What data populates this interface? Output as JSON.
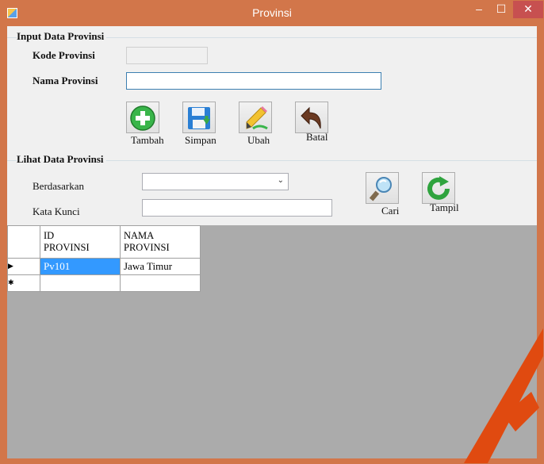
{
  "window": {
    "title": "Provinsi",
    "min_glyph": "–",
    "max_glyph": "☐",
    "close_glyph": "✕"
  },
  "input_group": {
    "title": "Input Data Provinsi",
    "kode_label": "Kode Provinsi",
    "kode_value": "",
    "nama_label": "Nama Provinsi",
    "nama_value": "",
    "buttons": {
      "tambah": "Tambah",
      "simpan": "Simpan",
      "ubah": "Ubah",
      "batal": "Batal"
    }
  },
  "view_group": {
    "title": "Lihat Data Provinsi",
    "berdasarkan_label": "Berdasarkan",
    "berdasarkan_value": "",
    "kata_kunci_label": "Kata Kunci",
    "kata_kunci_value": "",
    "buttons": {
      "cari": "Cari",
      "tampil": "Tampil"
    }
  },
  "grid": {
    "columns": [
      "ID\nPROVINSI",
      "NAMA\nPROVINSI"
    ],
    "rows": [
      {
        "marker": "▶",
        "id": "Pv101",
        "nama": "Jawa Timur"
      },
      {
        "marker": "✱",
        "id": "",
        "nama": ""
      }
    ]
  },
  "icons": {
    "tambah": "plus-icon",
    "simpan": "save-icon",
    "ubah": "edit-icon",
    "batal": "undo-icon",
    "cari": "search-icon",
    "tampil": "refresh-icon"
  }
}
